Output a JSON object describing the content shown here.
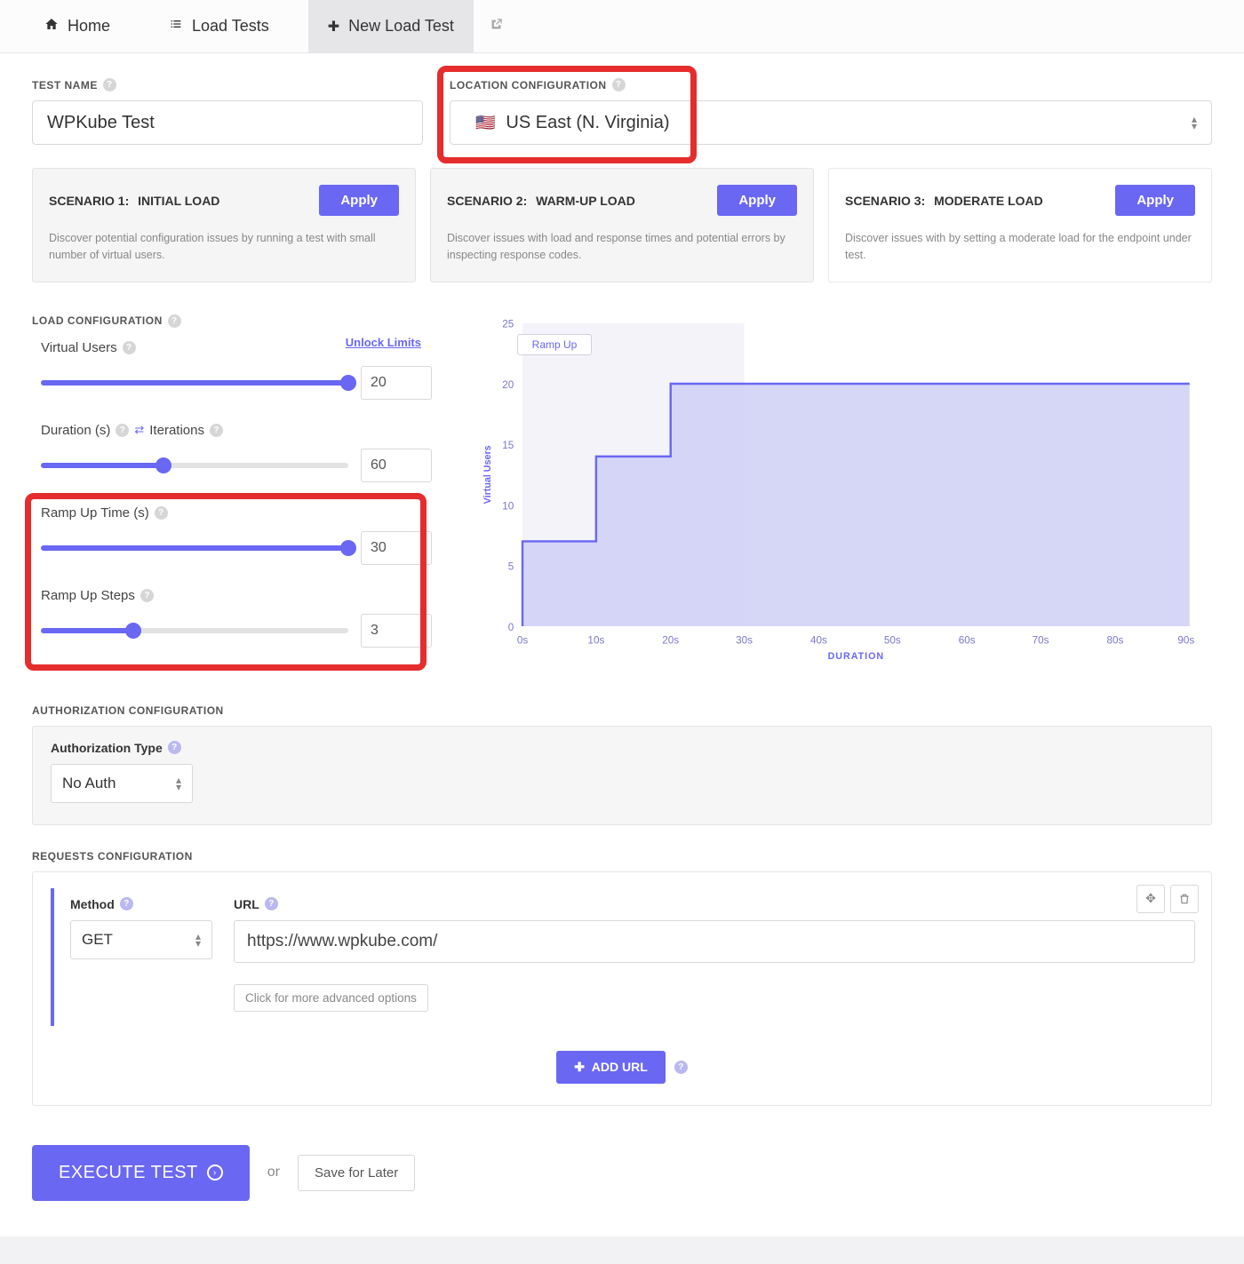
{
  "breadcrumb": {
    "home": "Home",
    "loadTests": "Load Tests",
    "newLoadTest": "New Load Test"
  },
  "testName": {
    "label": "TEST NAME",
    "value": "WPKube Test"
  },
  "location": {
    "label": "LOCATION CONFIGURATION",
    "flag": "🇺🇸",
    "value": "US East (N. Virginia)"
  },
  "scenarios": [
    {
      "title": "SCENARIO 1:",
      "subtitle": "INITIAL LOAD",
      "apply": "Apply",
      "desc": "Discover potential configuration issues by running a test with small number of virtual users."
    },
    {
      "title": "SCENARIO 2:",
      "subtitle": "WARM-UP LOAD",
      "apply": "Apply",
      "desc": "Discover issues with load and response times and potential errors by inspecting response codes."
    },
    {
      "title": "SCENARIO 3:",
      "subtitle": "MODERATE LOAD",
      "apply": "Apply",
      "desc": "Discover issues with by setting a moderate load for the endpoint under test."
    }
  ],
  "loadConfig": {
    "title": "LOAD CONFIGURATION",
    "unlock": "Unlock Limits",
    "virtualUsers": {
      "label": "Virtual Users",
      "value": "20",
      "fill": 100
    },
    "duration": {
      "label": "Duration (s)",
      "iterationsLabel": "Iterations",
      "value": "60",
      "fill": 40
    },
    "rampTime": {
      "label": "Ramp Up Time (s)",
      "value": "30",
      "fill": 100
    },
    "rampSteps": {
      "label": "Ramp Up Steps",
      "value": "3",
      "fill": 30
    }
  },
  "chart": {
    "legend": "Ramp Up",
    "ylabel": "Virtual Users",
    "xlabel": "DURATION"
  },
  "chart_data": {
    "type": "line",
    "title": "Ramp Up",
    "xlabel": "DURATION",
    "ylabel": "Virtual Users",
    "x_ticks": [
      "0s",
      "10s",
      "20s",
      "30s",
      "40s",
      "50s",
      "60s",
      "70s",
      "80s",
      "90s"
    ],
    "y_ticks": [
      0,
      5,
      10,
      15,
      20,
      25
    ],
    "xlim": [
      0,
      90
    ],
    "ylim": [
      0,
      25
    ],
    "ramp_highlight_end": 30,
    "series": [
      {
        "name": "Ramp Up",
        "step": true,
        "points": [
          {
            "x": 0,
            "y": 0
          },
          {
            "x": 0,
            "y": 7
          },
          {
            "x": 10,
            "y": 7
          },
          {
            "x": 10,
            "y": 14
          },
          {
            "x": 20,
            "y": 14
          },
          {
            "x": 20,
            "y": 20
          },
          {
            "x": 90,
            "y": 20
          }
        ]
      }
    ]
  },
  "auth": {
    "title": "AUTHORIZATION CONFIGURATION",
    "label": "Authorization Type",
    "value": "No Auth"
  },
  "requests": {
    "title": "REQUESTS CONFIGURATION",
    "methodLabel": "Method",
    "methodValue": "GET",
    "urlLabel": "URL",
    "urlValue": "https://www.wpkube.com/",
    "advanced": "Click for more advanced options",
    "addUrl": "ADD URL"
  },
  "footer": {
    "execute": "EXECUTE TEST",
    "or": "or",
    "save": "Save for Later"
  }
}
